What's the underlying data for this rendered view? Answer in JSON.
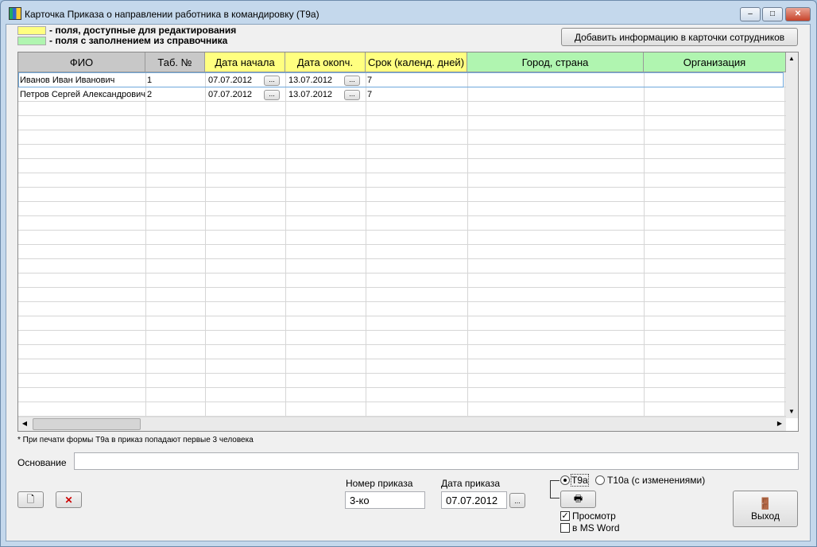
{
  "window": {
    "title": "Карточка Приказа о направлении работника в командировку (Т9а)"
  },
  "legend": {
    "editable": "- поля, доступные для редактирования",
    "reference": "- поля с заполнением из справочника",
    "colors": {
      "editable": "#ffff80",
      "reference": "#b0f5b0"
    }
  },
  "add_info_button": "Добавить информацию в карточки сотрудников",
  "table": {
    "columns": [
      "ФИО",
      "Таб. №",
      "Дата начала",
      "Дата окonч.",
      "Срок (календ. дней)",
      "Город, страна",
      "Организация"
    ],
    "rows": [
      {
        "fio": "Иванов Иван Иванович",
        "tab": "1",
        "start": "07.07.2012",
        "end": "13.07.2012",
        "days": "7",
        "city": "",
        "org": ""
      },
      {
        "fio": "Петров Сергей Александрович",
        "tab": "2",
        "start": "07.07.2012",
        "end": "13.07.2012",
        "days": "7",
        "city": "",
        "org": ""
      }
    ],
    "picker_label": "..."
  },
  "note": "* При печати формы Т9а в приказ попадают первые 3 человека",
  "basis": {
    "label": "Основание",
    "value": ""
  },
  "order_number": {
    "label": "Номер приказа",
    "value": "3-ко"
  },
  "order_date": {
    "label": "Дата приказа",
    "value": "07.07.2012",
    "picker": "..."
  },
  "form_choice": {
    "options": [
      "Т9а",
      "Т10а (с изменениями)"
    ],
    "selected": "Т9а"
  },
  "preview": {
    "label": "Просмотр",
    "checked": true
  },
  "msword": {
    "label": "в MS Word",
    "checked": false
  },
  "exit_button": "Выход"
}
